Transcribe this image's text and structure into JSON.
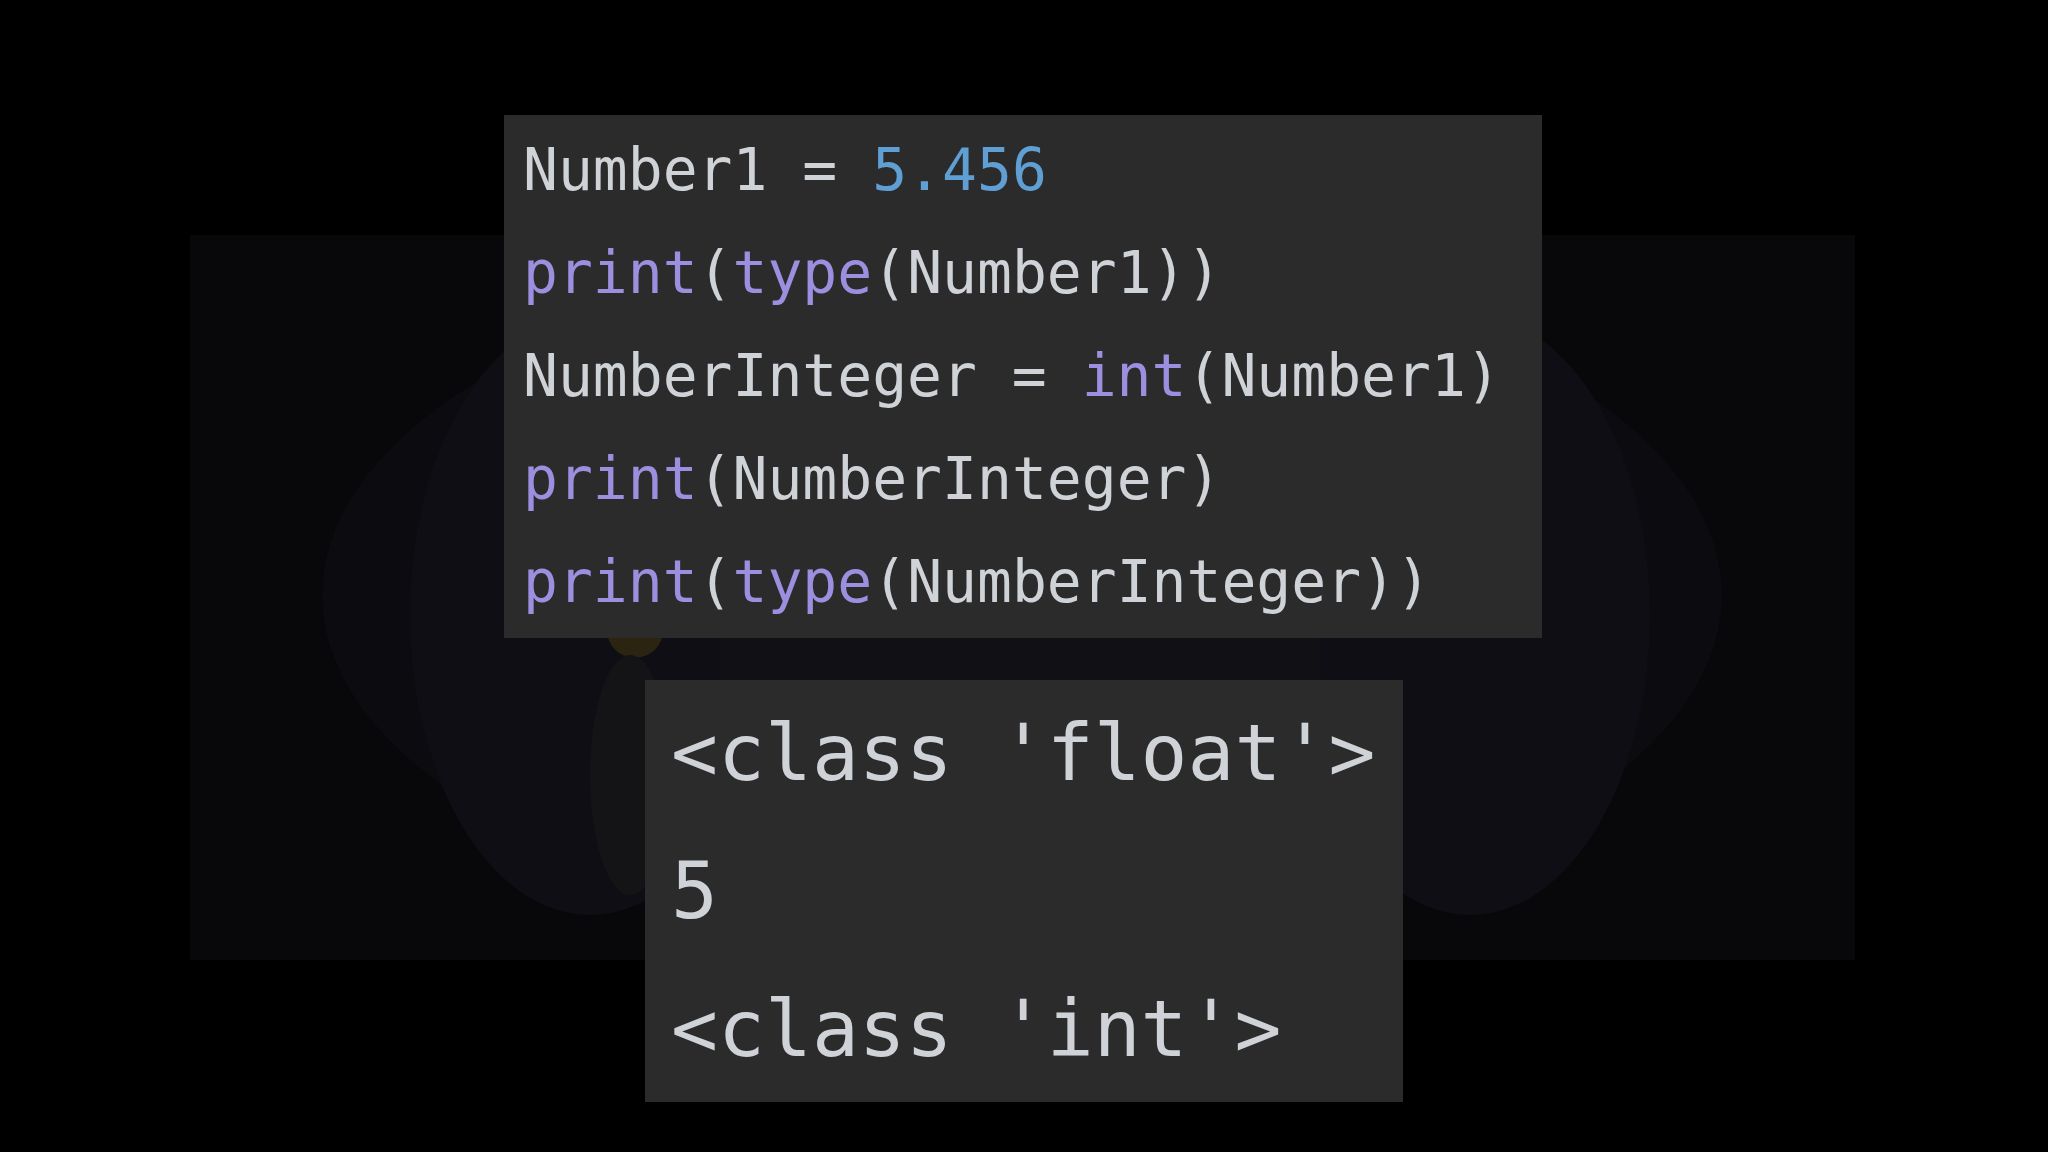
{
  "background": {
    "kind": "picture"
  },
  "code_lines": [
    {
      "tokens": [
        {
          "text": "Number1 = ",
          "kind": "plain"
        },
        {
          "text": "5.456",
          "kind": "number"
        }
      ]
    },
    {
      "tokens": [
        {
          "text": "print",
          "kind": "builtin"
        },
        {
          "text": "(",
          "kind": "plain"
        },
        {
          "text": "type",
          "kind": "builtin"
        },
        {
          "text": "(Number1))",
          "kind": "plain"
        }
      ]
    },
    {
      "tokens": [
        {
          "text": "NumberInteger = ",
          "kind": "plain"
        },
        {
          "text": "int",
          "kind": "builtin"
        },
        {
          "text": "(Number1)",
          "kind": "plain"
        }
      ]
    },
    {
      "tokens": [
        {
          "text": "print",
          "kind": "builtin"
        },
        {
          "text": "(NumberInteger)",
          "kind": "plain"
        }
      ]
    },
    {
      "tokens": [
        {
          "text": "print",
          "kind": "builtin"
        },
        {
          "text": "(",
          "kind": "plain"
        },
        {
          "text": "type",
          "kind": "builtin"
        },
        {
          "text": "(NumberInteger))",
          "kind": "plain"
        }
      ]
    }
  ],
  "output_lines": [
    "<class 'float'>",
    "5",
    "<class 'int'>"
  ]
}
